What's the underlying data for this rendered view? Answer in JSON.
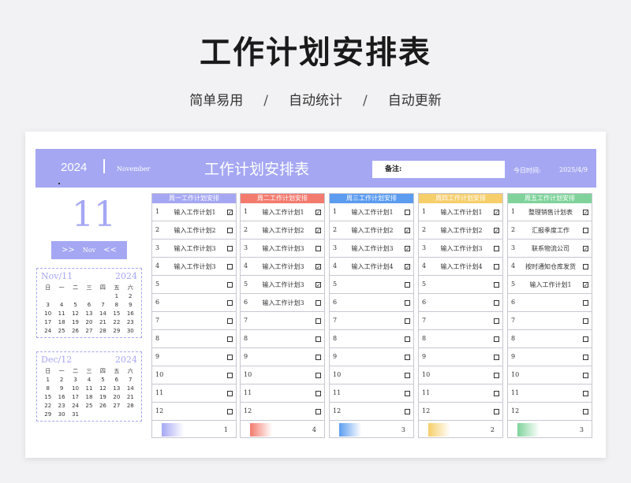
{
  "page": {
    "headline": "工作计划安排表",
    "tagline": [
      "简单易用",
      "自动统计",
      "自动更新"
    ],
    "tagline_sep": "/"
  },
  "banner": {
    "year": "2024",
    "month": "November",
    "title": "工作计划安排表",
    "notes_label": "备注:",
    "today_label": "今日时间:",
    "today_value": "2025/4/9"
  },
  "sidebar": {
    "big_day": "11",
    "nav_prev": ">>",
    "nav_label": "Nov",
    "nav_next": "<<",
    "calendars": [
      {
        "month": "Nov/11",
        "year": "2024",
        "weekdays": [
          "日",
          "一",
          "二",
          "三",
          "四",
          "五",
          "六"
        ],
        "days": [
          "",
          "",
          "",
          "",
          "",
          "1",
          "2",
          "3",
          "4",
          "5",
          "6",
          "7",
          "8",
          "9",
          "10",
          "11",
          "12",
          "13",
          "14",
          "15",
          "16",
          "17",
          "18",
          "19",
          "20",
          "21",
          "22",
          "23",
          "24",
          "25",
          "26",
          "27",
          "28",
          "29",
          "30"
        ]
      },
      {
        "month": "Dec/12",
        "year": "2024",
        "weekdays": [
          "日",
          "一",
          "二",
          "三",
          "四",
          "五",
          "六"
        ],
        "days": [
          "1",
          "2",
          "3",
          "4",
          "5",
          "6",
          "7",
          "8",
          "9",
          "10",
          "11",
          "12",
          "13",
          "14",
          "15",
          "16",
          "17",
          "18",
          "19",
          "20",
          "21",
          "22",
          "23",
          "24",
          "25",
          "26",
          "27",
          "28",
          "29",
          "30",
          "31"
        ]
      }
    ]
  },
  "columns": [
    {
      "header": "周一工作计划安排",
      "color": "#a5a7f3",
      "count": "1",
      "tasks": [
        {
          "n": "1",
          "text": "输入工作计划1",
          "done": true
        },
        {
          "n": "2",
          "text": "输入工作计划2",
          "done": false
        },
        {
          "n": "3",
          "text": "输入工作计划3",
          "done": false
        },
        {
          "n": "4",
          "text": "输入工作计划3",
          "done": false
        },
        {
          "n": "5",
          "text": "",
          "done": false
        },
        {
          "n": "6",
          "text": "",
          "done": false
        },
        {
          "n": "7",
          "text": "",
          "done": false
        },
        {
          "n": "8",
          "text": "",
          "done": false
        },
        {
          "n": "9",
          "text": "",
          "done": false
        },
        {
          "n": "10",
          "text": "",
          "done": false
        },
        {
          "n": "11",
          "text": "",
          "done": false
        },
        {
          "n": "12",
          "text": "",
          "done": false
        }
      ]
    },
    {
      "header": "周二工作计划安排",
      "color": "#f37b6e",
      "count": "4",
      "tasks": [
        {
          "n": "1",
          "text": "输入工作计划1",
          "done": true
        },
        {
          "n": "2",
          "text": "输入工作计划2",
          "done": true
        },
        {
          "n": "3",
          "text": "输入工作计划3",
          "done": false
        },
        {
          "n": "4",
          "text": "输入工作计划3",
          "done": true
        },
        {
          "n": "5",
          "text": "输入工作计划3",
          "done": true
        },
        {
          "n": "6",
          "text": "输入工作计划3",
          "done": false
        },
        {
          "n": "7",
          "text": "",
          "done": false
        },
        {
          "n": "8",
          "text": "",
          "done": false
        },
        {
          "n": "9",
          "text": "",
          "done": false
        },
        {
          "n": "10",
          "text": "",
          "done": false
        },
        {
          "n": "11",
          "text": "",
          "done": false
        },
        {
          "n": "12",
          "text": "",
          "done": false
        }
      ]
    },
    {
      "header": "周三工作计划安排",
      "color": "#5b9cf0",
      "count": "3",
      "tasks": [
        {
          "n": "1",
          "text": "输入工作计划1",
          "done": false
        },
        {
          "n": "2",
          "text": "输入工作计划2",
          "done": true
        },
        {
          "n": "3",
          "text": "输入工作计划3",
          "done": true
        },
        {
          "n": "4",
          "text": "输入工作计划4",
          "done": true
        },
        {
          "n": "5",
          "text": "",
          "done": false
        },
        {
          "n": "6",
          "text": "",
          "done": false
        },
        {
          "n": "7",
          "text": "",
          "done": false
        },
        {
          "n": "8",
          "text": "",
          "done": false
        },
        {
          "n": "9",
          "text": "",
          "done": false
        },
        {
          "n": "10",
          "text": "",
          "done": false
        },
        {
          "n": "11",
          "text": "",
          "done": false
        },
        {
          "n": "12",
          "text": "",
          "done": false
        }
      ]
    },
    {
      "header": "周四工作计划安排",
      "color": "#f6ce6a",
      "count": "2",
      "tasks": [
        {
          "n": "1",
          "text": "输入工作计划1",
          "done": true
        },
        {
          "n": "2",
          "text": "输入工作计划2",
          "done": true
        },
        {
          "n": "3",
          "text": "输入工作计划3",
          "done": false
        },
        {
          "n": "4",
          "text": "输入工作计划4",
          "done": false
        },
        {
          "n": "5",
          "text": "",
          "done": false
        },
        {
          "n": "6",
          "text": "",
          "done": false
        },
        {
          "n": "7",
          "text": "",
          "done": false
        },
        {
          "n": "8",
          "text": "",
          "done": false
        },
        {
          "n": "9",
          "text": "",
          "done": false
        },
        {
          "n": "10",
          "text": "",
          "done": false
        },
        {
          "n": "11",
          "text": "",
          "done": false
        },
        {
          "n": "12",
          "text": "",
          "done": false
        }
      ]
    },
    {
      "header": "周五工作计划安排",
      "color": "#7fd39a",
      "count": "3",
      "tasks": [
        {
          "n": "1",
          "text": "整理销售计划表",
          "done": true
        },
        {
          "n": "2",
          "text": "汇报季度工作",
          "done": false
        },
        {
          "n": "3",
          "text": "联系物流公司",
          "done": true
        },
        {
          "n": "4",
          "text": "按时通知仓库发货",
          "done": false
        },
        {
          "n": "5",
          "text": "输入工作计划1",
          "done": true
        },
        {
          "n": "6",
          "text": "",
          "done": false
        },
        {
          "n": "7",
          "text": "",
          "done": false
        },
        {
          "n": "8",
          "text": "",
          "done": false
        },
        {
          "n": "9",
          "text": "",
          "done": false
        },
        {
          "n": "10",
          "text": "",
          "done": false
        },
        {
          "n": "11",
          "text": "",
          "done": false
        },
        {
          "n": "12",
          "text": "",
          "done": false
        }
      ]
    }
  ]
}
